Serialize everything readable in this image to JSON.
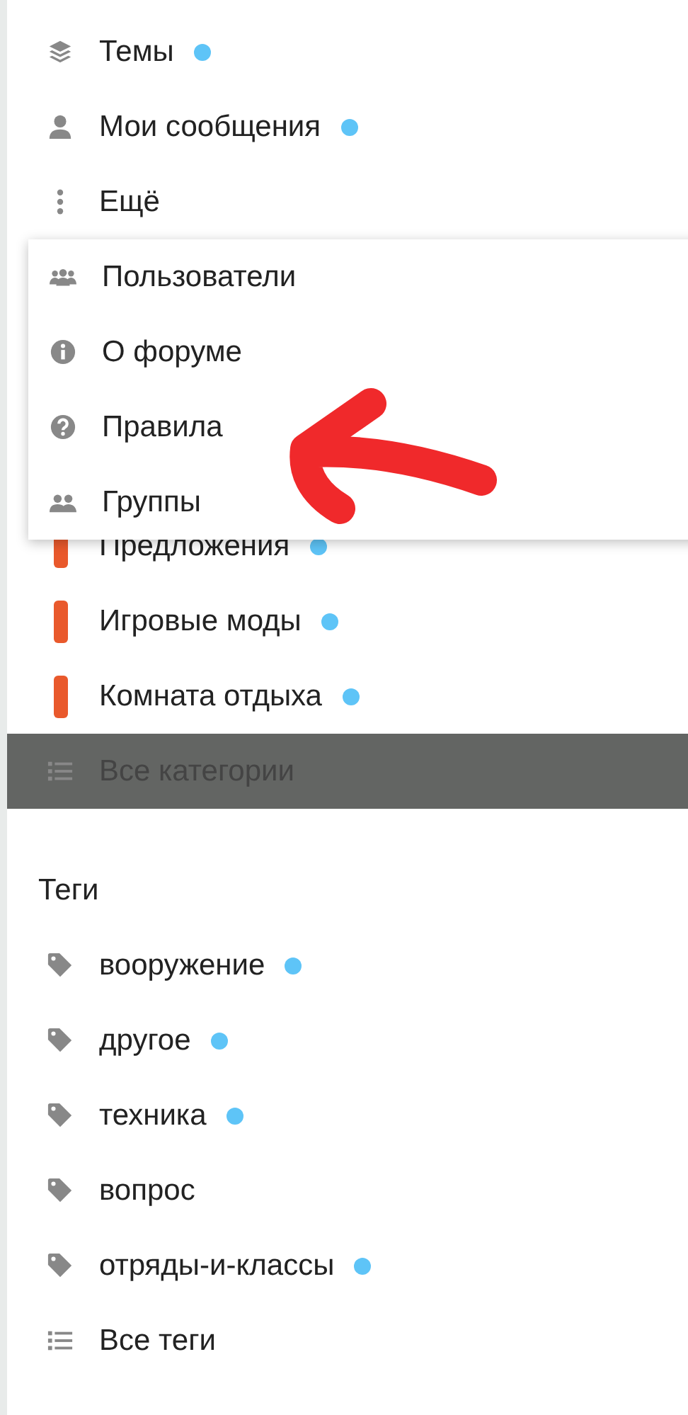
{
  "nav": [
    {
      "kind": "topics",
      "label": "Темы",
      "unread": true
    },
    {
      "kind": "user",
      "label": "Мои сообщения",
      "unread": true
    },
    {
      "kind": "more",
      "label": "Ещё",
      "expanded": true
    }
  ],
  "more_menu": [
    {
      "kind": "users",
      "label": "Пользователи"
    },
    {
      "kind": "info",
      "label": "О форуме"
    },
    {
      "kind": "question",
      "label": "Правила"
    },
    {
      "kind": "groups",
      "label": "Группы"
    }
  ],
  "categories": [
    {
      "kind": "category",
      "label": "Предложения",
      "color": "#e9592c",
      "unread": true,
      "selected": false
    },
    {
      "kind": "category",
      "label": "Игровые моды",
      "color": "#e9592c",
      "unread": true,
      "selected": false
    },
    {
      "kind": "category",
      "label": "Комната отдыха",
      "color": "#e9592c",
      "unread": true,
      "selected": false
    },
    {
      "kind": "all",
      "label": "Все категории",
      "selected": true
    }
  ],
  "tags_heading": "Теги",
  "tags": [
    {
      "kind": "tag",
      "label": "вооружение",
      "unread": true
    },
    {
      "kind": "tag",
      "label": "другое",
      "unread": true
    },
    {
      "kind": "tag",
      "label": "техника",
      "unread": true
    },
    {
      "kind": "tag",
      "label": "вопрос",
      "unread": false
    },
    {
      "kind": "tag",
      "label": "отряды-и-классы",
      "unread": true
    },
    {
      "kind": "all",
      "label": "Все теги"
    }
  ]
}
